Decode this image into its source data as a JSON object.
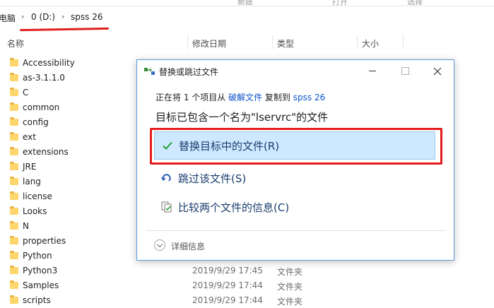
{
  "ribbon": {
    "items": [
      "新建",
      "打开",
      "选择"
    ]
  },
  "address": {
    "root": "电脑",
    "drive": "0 (D:)",
    "folder": "spss 26"
  },
  "columns": {
    "name": "名称",
    "modified": "修改日期",
    "type": "类型",
    "size": "大小"
  },
  "files": [
    {
      "name": "Accessibility",
      "date": "",
      "type": ""
    },
    {
      "name": "as-3.1.1.0",
      "date": "",
      "type": ""
    },
    {
      "name": "C",
      "date": "",
      "type": ""
    },
    {
      "name": "common",
      "date": "",
      "type": ""
    },
    {
      "name": "config",
      "date": "",
      "type": ""
    },
    {
      "name": "ext",
      "date": "",
      "type": ""
    },
    {
      "name": "extensions",
      "date": "",
      "type": ""
    },
    {
      "name": "JRE",
      "date": "",
      "type": ""
    },
    {
      "name": "lang",
      "date": "",
      "type": ""
    },
    {
      "name": "license",
      "date": "",
      "type": ""
    },
    {
      "name": "Looks",
      "date": "",
      "type": ""
    },
    {
      "name": "N",
      "date": "",
      "type": ""
    },
    {
      "name": "properties",
      "date": "",
      "type": ""
    },
    {
      "name": "Python",
      "date": "",
      "type": ""
    },
    {
      "name": "Python3",
      "date": "2019/9/29 17:45",
      "type": "文件夹"
    },
    {
      "name": "Samples",
      "date": "2019/9/29 17:44",
      "type": "文件夹"
    },
    {
      "name": "scripts",
      "date": "2019/9/29 17:44",
      "type": "文件夹"
    }
  ],
  "dialog": {
    "title": "替换或跳过文件",
    "from_prefix": "正在将 1 个项目从 ",
    "from_source": "破解文件",
    "from_middle": " 复制到 ",
    "from_dest": "spss 26",
    "conflict_message": "目标已包含一个名为\"lservrc\"的文件",
    "option_replace": "替换目标中的文件(R)",
    "option_skip": "跳过该文件(S)",
    "option_compare": "比较两个文件的信息(C)",
    "details": "详细信息"
  },
  "colors": {
    "accent": "#0a55c8",
    "highlight_fill": "#cde8ff",
    "annotation_red": "#e21d1d",
    "check_green": "#2a9d3a"
  }
}
